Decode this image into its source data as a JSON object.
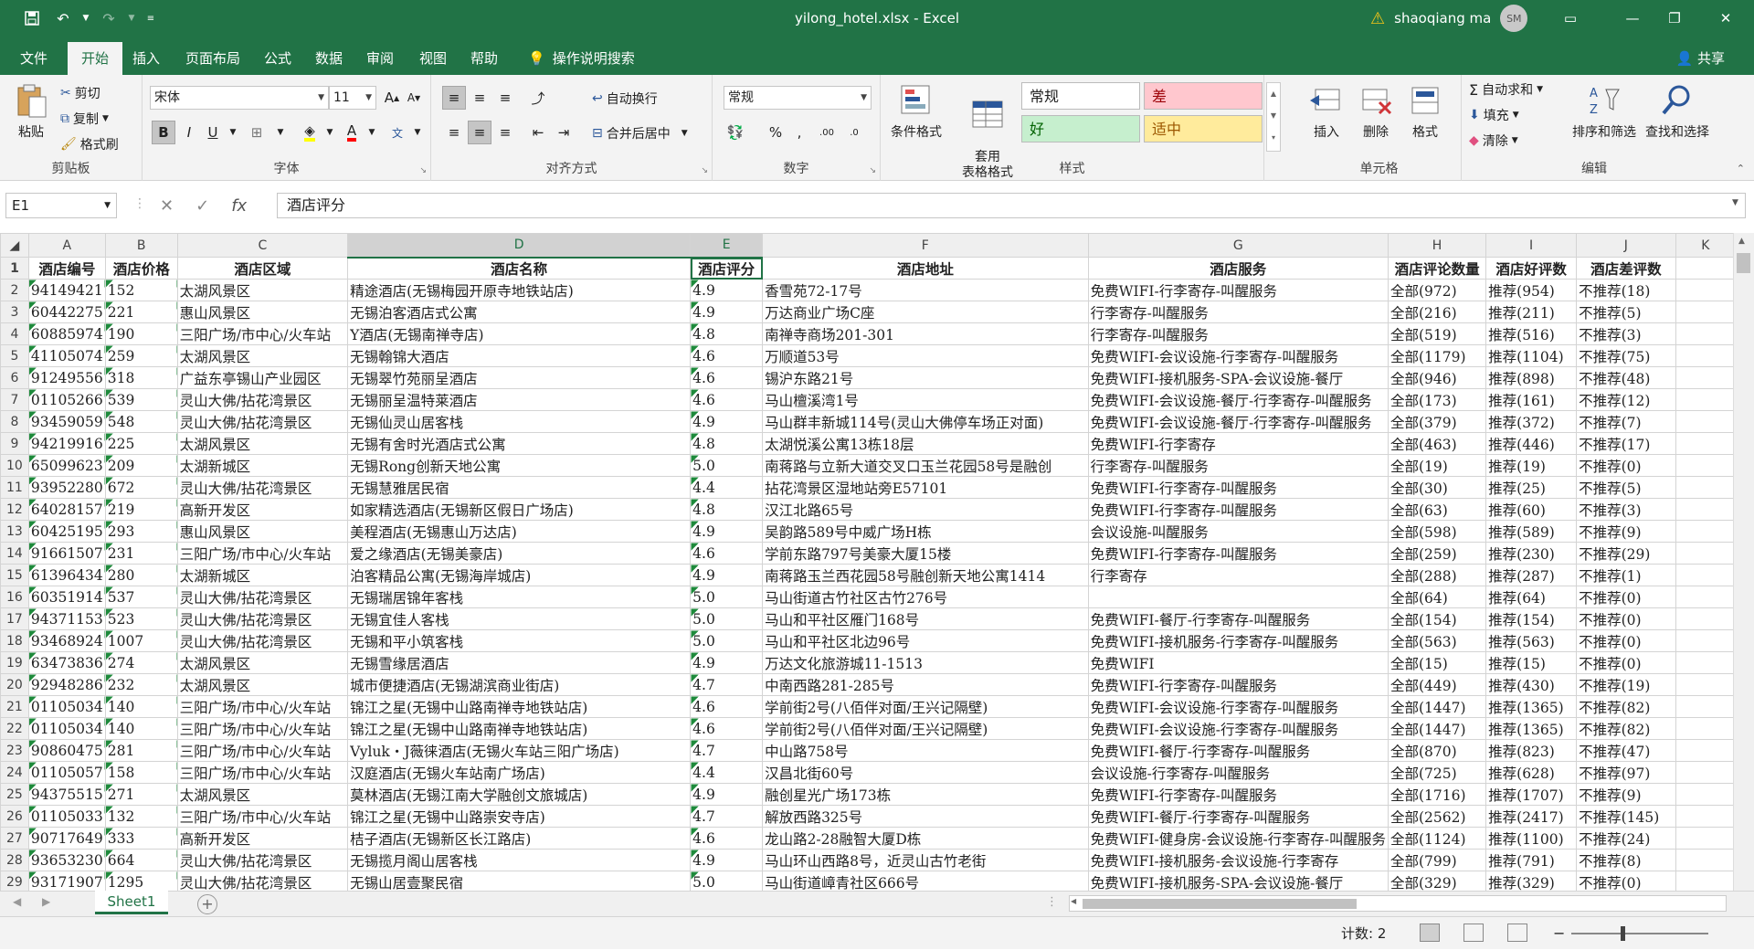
{
  "window": {
    "title": "yilong_hotel.xlsx  -  Excel",
    "user_name": "shaoqiang ma",
    "user_initials": "SM",
    "warning_icon": "warning-icon",
    "accent": "#217346"
  },
  "ribbon_tabs": [
    "文件",
    "开始",
    "插入",
    "页面布局",
    "公式",
    "数据",
    "审阅",
    "视图",
    "帮助"
  ],
  "active_tab": "开始",
  "tell_me": "操作说明搜索",
  "share": "共享",
  "clipboard": {
    "paste": "粘贴",
    "cut": "剪切",
    "copy": "复制",
    "format_painter": "格式刷",
    "label": "剪贴板"
  },
  "font": {
    "name": "宋体",
    "size": "11",
    "label": "字体"
  },
  "alignment": {
    "wrap": "自动换行",
    "merge": "合并后居中",
    "label": "对齐方式"
  },
  "number": {
    "format": "常规",
    "label": "数字"
  },
  "styles": {
    "conditional": "条件格式",
    "table_format": "套用\n表格格式",
    "normal": "常规",
    "bad": "差",
    "good": "好",
    "neutral": "适中",
    "label": "样式",
    "colors": {
      "normal_bg": "#ffffff",
      "bad_bg": "#ffc7ce",
      "bad_fg": "#9c0006",
      "good_bg": "#c6efce",
      "good_fg": "#006100",
      "neutral_bg": "#ffeb9c",
      "neutral_fg": "#9c5700"
    }
  },
  "cells_group": {
    "insert": "插入",
    "delete": "删除",
    "format": "格式",
    "label": "单元格"
  },
  "editing": {
    "autosum": "自动求和",
    "fill": "填充",
    "clear": "清除",
    "sort_filter": "排序和筛选",
    "find_select": "查找和选择",
    "label": "编辑"
  },
  "formula_bar": {
    "name_box": "E1",
    "content": "酒店评分"
  },
  "columns": [
    "A",
    "B",
    "C",
    "D",
    "E",
    "F",
    "G",
    "H",
    "I",
    "J",
    "K"
  ],
  "header_row": [
    "酒店编号",
    "酒店价格",
    "酒店区域",
    "酒店名称",
    "酒店评分",
    "酒店地址",
    "酒店服务",
    "酒店评论数量",
    "酒店好评数",
    "酒店差评数"
  ],
  "rows": [
    [
      "94149421",
      "152",
      "太湖风景区",
      "精途酒店(无锡梅园开原寺地铁站店)",
      "4.9",
      "香雪苑72-17号",
      "免费WIFI-行李寄存-叫醒服务",
      "全部(972)",
      "推荐(954)",
      "不推荐(18)"
    ],
    [
      "60442275",
      "221",
      "惠山风景区",
      "无锡泊客酒店式公寓",
      "4.9",
      "万达商业广场C座",
      "行李寄存-叫醒服务",
      "全部(216)",
      "推荐(211)",
      "不推荐(5)"
    ],
    [
      "60885974",
      "190",
      "三阳广场/市中心/火车站",
      "Y酒店(无锡南禅寺店)",
      "4.8",
      "南禅寺商场201-301",
      "行李寄存-叫醒服务",
      "全部(519)",
      "推荐(516)",
      "不推荐(3)"
    ],
    [
      "41105074",
      "259",
      "太湖风景区",
      "无锡翰锦大酒店",
      "4.6",
      "万顺道53号",
      "免费WIFI-会议设施-行李寄存-叫醒服务",
      "全部(1179)",
      "推荐(1104)",
      "不推荐(75)"
    ],
    [
      "91249556",
      "318",
      "广益东亭锡山产业园区",
      "无锡翠竹苑丽呈酒店",
      "4.6",
      "锡沪东路21号",
      "免费WIFI-接机服务-SPA-会议设施-餐厅",
      "全部(946)",
      "推荐(898)",
      "不推荐(48)"
    ],
    [
      "01105266",
      "539",
      "灵山大佛/拈花湾景区",
      "无锡丽呈温特莱酒店",
      "4.6",
      "马山檀溪湾1号",
      "免费WIFI-会议设施-餐厅-行李寄存-叫醒服务",
      "全部(173)",
      "推荐(161)",
      "不推荐(12)"
    ],
    [
      "93459059",
      "548",
      "灵山大佛/拈花湾景区",
      "无锡仙灵山居客栈",
      "4.9",
      "马山群丰新城114号(灵山大佛停车场正对面)",
      "免费WIFI-会议设施-餐厅-行李寄存-叫醒服务",
      "全部(379)",
      "推荐(372)",
      "不推荐(7)"
    ],
    [
      "94219916",
      "225",
      "太湖风景区",
      "无锡有舍时光酒店式公寓",
      "4.8",
      "太湖悦溪公寓13栋18层",
      "免费WIFI-行李寄存",
      "全部(463)",
      "推荐(446)",
      "不推荐(17)"
    ],
    [
      "65099623",
      "209",
      "太湖新城区",
      "无锡Rong创新天地公寓",
      "5.0",
      "南蒋路与立新大道交叉口玉兰花园58号是融创",
      "行李寄存-叫醒服务",
      "全部(19)",
      "推荐(19)",
      "不推荐(0)"
    ],
    [
      "93952280",
      "672",
      "灵山大佛/拈花湾景区",
      "无锡慧雅居民宿",
      "4.4",
      "拈花湾景区湿地站旁E57101",
      "免费WIFI-行李寄存-叫醒服务",
      "全部(30)",
      "推荐(25)",
      "不推荐(5)"
    ],
    [
      "64028157",
      "219",
      "高新开发区",
      "如家精选酒店(无锡新区假日广场店)",
      "4.8",
      "汉江北路65号",
      "免费WIFI-行李寄存-叫醒服务",
      "全部(63)",
      "推荐(60)",
      "不推荐(3)"
    ],
    [
      "60425195",
      "293",
      "惠山风景区",
      "美程酒店(无锡惠山万达店)",
      "4.9",
      "吴韵路589号中威广场H栋",
      "会议设施-叫醒服务",
      "全部(598)",
      "推荐(589)",
      "不推荐(9)"
    ],
    [
      "91661507",
      "231",
      "三阳广场/市中心/火车站",
      "爱之缘酒店(无锡美豪店)",
      "4.6",
      "学前东路797号美豪大厦15楼",
      "免费WIFI-行李寄存-叫醒服务",
      "全部(259)",
      "推荐(230)",
      "不推荐(29)"
    ],
    [
      "61396434",
      "280",
      "太湖新城区",
      "泊客精品公寓(无锡海岸城店)",
      "4.9",
      "南蒋路玉兰西花园58号融创新天地公寓1414",
      "行李寄存",
      "全部(288)",
      "推荐(287)",
      "不推荐(1)"
    ],
    [
      "60351914",
      "537",
      "灵山大佛/拈花湾景区",
      "无锡瑞居锦年客栈",
      "5.0",
      "马山街道古竹社区古竹276号",
      "",
      "全部(64)",
      "推荐(64)",
      "不推荐(0)"
    ],
    [
      "94371153",
      "523",
      "灵山大佛/拈花湾景区",
      "无锡宜佳人客栈",
      "5.0",
      "马山和平社区雁门168号",
      "免费WIFI-餐厅-行李寄存-叫醒服务",
      "全部(154)",
      "推荐(154)",
      "不推荐(0)"
    ],
    [
      "93468924",
      "1007",
      "灵山大佛/拈花湾景区",
      "无锡和平小筑客栈",
      "5.0",
      "马山和平社区北边96号",
      "免费WIFI-接机服务-行李寄存-叫醒服务",
      "全部(563)",
      "推荐(563)",
      "不推荐(0)"
    ],
    [
      "63473836",
      "274",
      "太湖风景区",
      "无锡雪缘居酒店",
      "4.9",
      "万达文化旅游城11-1513",
      "免费WIFI",
      "全部(15)",
      "推荐(15)",
      "不推荐(0)"
    ],
    [
      "92948286",
      "232",
      "太湖风景区",
      "城市便捷酒店(无锡湖滨商业街店)",
      "4.7",
      "中南西路281-285号",
      "免费WIFI-行李寄存-叫醒服务",
      "全部(449)",
      "推荐(430)",
      "不推荐(19)"
    ],
    [
      "01105034",
      "140",
      "三阳广场/市中心/火车站",
      "锦江之星(无锡中山路南禅寺地铁站店)",
      "4.6",
      "学前街2号(八佰伴对面/王兴记隔壁)",
      "免费WIFI-会议设施-行李寄存-叫醒服务",
      "全部(1447)",
      "推荐(1365)",
      "不推荐(82)"
    ],
    [
      "01105034",
      "140",
      "三阳广场/市中心/火车站",
      "锦江之星(无锡中山路南禅寺地铁站店)",
      "4.6",
      "学前街2号(八佰伴对面/王兴记隔壁)",
      "免费WIFI-会议设施-行李寄存-叫醒服务",
      "全部(1447)",
      "推荐(1365)",
      "不推荐(82)"
    ],
    [
      "90860475",
      "281",
      "三阳广场/市中心/火车站",
      "Vyluk・J薇徕酒店(无锡火车站三阳广场店)",
      "4.7",
      "中山路758号",
      "免费WIFI-餐厅-行李寄存-叫醒服务",
      "全部(870)",
      "推荐(823)",
      "不推荐(47)"
    ],
    [
      "01105057",
      "158",
      "三阳广场/市中心/火车站",
      "汉庭酒店(无锡火车站南广场店)",
      "4.4",
      "汉昌北街60号",
      "会议设施-行李寄存-叫醒服务",
      "全部(725)",
      "推荐(628)",
      "不推荐(97)"
    ],
    [
      "94375515",
      "271",
      "太湖风景区",
      "莫林酒店(无锡江南大学融创文旅城店)",
      "4.9",
      "融创星光广场173栋",
      "免费WIFI-行李寄存-叫醒服务",
      "全部(1716)",
      "推荐(1707)",
      "不推荐(9)"
    ],
    [
      "01105033",
      "132",
      "三阳广场/市中心/火车站",
      "锦江之星(无锡中山路崇安寺店)",
      "4.7",
      "解放西路325号",
      "免费WIFI-餐厅-行李寄存-叫醒服务",
      "全部(2562)",
      "推荐(2417)",
      "不推荐(145)"
    ],
    [
      "90717649",
      "333",
      "高新开发区",
      "桔子酒店(无锡新区长江路店)",
      "4.6",
      "龙山路2-28融智大厦D栋",
      "免费WIFI-健身房-会议设施-行李寄存-叫醒服务",
      "全部(1124)",
      "推荐(1100)",
      "不推荐(24)"
    ],
    [
      "93653230",
      "664",
      "灵山大佛/拈花湾景区",
      "无锡揽月阁山居客栈",
      "4.9",
      "马山环山西路8号，近灵山古竹老街",
      "免费WIFI-接机服务-会议设施-行李寄存",
      "全部(799)",
      "推荐(791)",
      "不推荐(8)"
    ],
    [
      "93171907",
      "1295",
      "灵山大佛/拈花湾景区",
      "无锡山居壹聚民宿",
      "5.0",
      "马山街道嶂青社区666号",
      "免费WIFI-接机服务-SPA-会议设施-餐厅",
      "全部(329)",
      "推荐(329)",
      "不推荐(0)"
    ]
  ],
  "sheet_tab": "Sheet1",
  "status": {
    "count": "计数: 2"
  }
}
